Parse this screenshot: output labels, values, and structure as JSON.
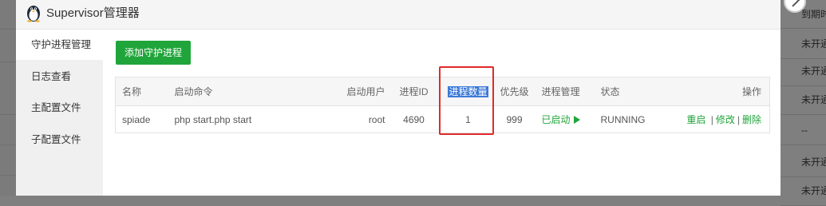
{
  "dialog": {
    "title": "Supervisor管理器",
    "sidebar": [
      {
        "label": "守护进程管理",
        "active": true
      },
      {
        "label": "日志查看",
        "active": false
      },
      {
        "label": "主配置文件",
        "active": false
      },
      {
        "label": "子配置文件",
        "active": false
      }
    ],
    "add_button": "添加守护进程",
    "table": {
      "headers": {
        "name": "名称",
        "command": "启动命令",
        "user": "启动用户",
        "pid": "进程ID",
        "count": "进程数量",
        "priority": "优先级",
        "manage": "进程管理",
        "status": "状态",
        "ops": "操作"
      },
      "rows": [
        {
          "name": "spiade",
          "command": "php start.php start",
          "user": "root",
          "pid": "4690",
          "count": "1",
          "priority": "999",
          "manage": "已启动",
          "status": "RUNNING",
          "op_restart": "重启",
          "op_sep": "|",
          "op_edit": "修改",
          "op_delete": "删除"
        }
      ]
    }
  },
  "background": {
    "right_column": [
      "到期时",
      "未开通",
      "未开通",
      "未开通",
      "--",
      "未开通",
      "未开通"
    ]
  },
  "colors": {
    "accent_green": "#20a53a",
    "highlight_blue": "#3d7ad8",
    "annotation_red": "#e12a2a"
  }
}
